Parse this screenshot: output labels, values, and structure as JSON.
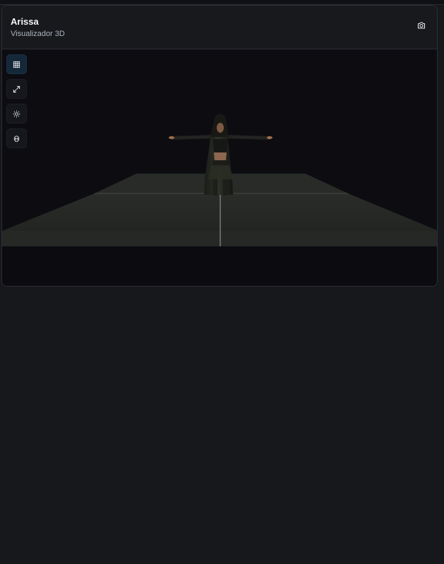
{
  "window": {
    "title": "Arissa",
    "subtitle": "Visualizador 3D"
  },
  "toolbar": {
    "buttons": [
      {
        "icon": "grid-icon",
        "active": true
      },
      {
        "icon": "expand-icon",
        "active": false
      },
      {
        "icon": "sun-icon",
        "active": false
      },
      {
        "icon": "skull-icon",
        "active": false
      }
    ]
  },
  "header_actions": {
    "snapshot_icon": "camera-icon"
  },
  "colors": {
    "background": "#16181c",
    "card": "#0c0d12",
    "header": "#17191d",
    "active_tool": "#15283a",
    "floor": "#272a27",
    "icon": "#e5e7eb"
  }
}
